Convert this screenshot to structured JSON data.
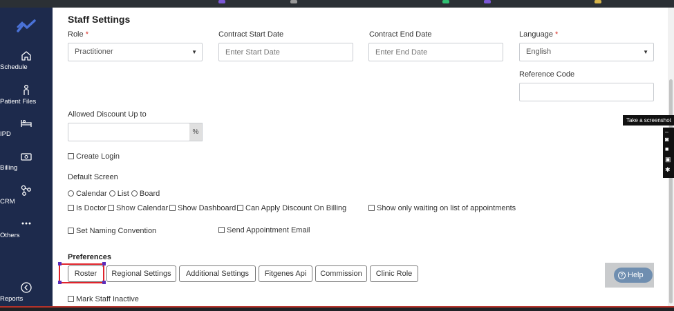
{
  "sidebar": {
    "items": [
      {
        "label": "Schedule",
        "icon": "home-icon"
      },
      {
        "label": "Patient Files",
        "icon": "person-icon"
      },
      {
        "label": "IPD",
        "icon": "bed-icon"
      },
      {
        "label": "Billing",
        "icon": "cash-icon"
      },
      {
        "label": "CRM",
        "icon": "crm-nodes-icon"
      },
      {
        "label": "Others",
        "icon": "more-dots-icon"
      },
      {
        "label": "Reports",
        "icon": "reports-icon"
      }
    ]
  },
  "page": {
    "title": "Staff Settings"
  },
  "form": {
    "role": {
      "label": "Role",
      "required": "*",
      "value": "Practitioner"
    },
    "contract_start": {
      "label": "Contract Start Date",
      "placeholder": "Enter Start Date"
    },
    "contract_end": {
      "label": "Contract End Date",
      "placeholder": "Enter End Date"
    },
    "language": {
      "label": "Language",
      "required": "*",
      "value": "English"
    },
    "reference_code": {
      "label": "Reference Code",
      "value": ""
    },
    "discount": {
      "label": "Allowed Discount Up to",
      "value": "",
      "suffix": "%"
    },
    "create_login": {
      "label": "Create Login",
      "checked": false
    },
    "default_screen": {
      "label": "Default Screen",
      "options": [
        "Calendar",
        "List",
        "Board"
      ]
    },
    "flags": {
      "is_doctor": "Is Doctor",
      "show_calendar": "Show Calendar",
      "show_dashboard": "Show Dashboard",
      "apply_discount": "Can Apply Discount On Billing",
      "show_waiting": "Show only waiting on list of appointments",
      "naming_convention": "Set Naming Convention",
      "send_email": "Send Appointment Email",
      "mark_inactive": "Mark Staff Inactive"
    }
  },
  "preferences": {
    "label": "Preferences",
    "buttons": [
      "Roster",
      "Regional Settings",
      "Additional Settings",
      "Fitgenes Api",
      "Commission",
      "Clinic Role"
    ]
  },
  "help": {
    "label": "Help"
  },
  "overlay": {
    "tooltip": "Take a screenshot"
  },
  "colors": {
    "sidebar_bg": "#1d2a4c",
    "accent": "#4a72d8",
    "selection_border": "#e0232b",
    "help_bg": "#6f8eb0"
  }
}
